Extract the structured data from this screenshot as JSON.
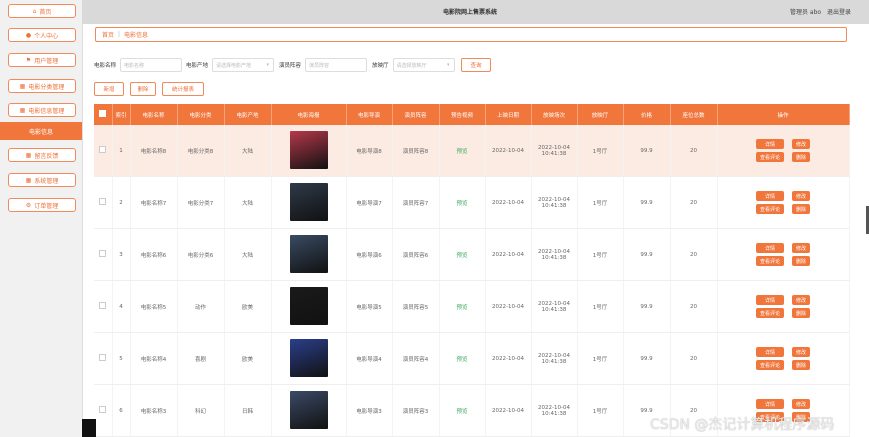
{
  "header": {
    "title": "电影院网上售票系统",
    "admin": "管理员 abo",
    "logout": "退出登录"
  },
  "sidebar": {
    "items": [
      {
        "label": "首页",
        "icon": "home-icon",
        "glyph": "⌂"
      },
      {
        "label": "个人中心",
        "icon": "user-icon",
        "glyph": "●"
      },
      {
        "label": "用户管理",
        "icon": "flag-icon",
        "glyph": "⚑"
      },
      {
        "label": "电影分类管理",
        "icon": "grid-icon",
        "glyph": "▦"
      },
      {
        "label": "电影信息管理",
        "icon": "grid-icon",
        "glyph": "▦"
      },
      {
        "label": "电影信息",
        "icon": "",
        "glyph": ""
      },
      {
        "label": "留言反馈",
        "icon": "grid-icon",
        "glyph": "▦"
      },
      {
        "label": "系统管理",
        "icon": "grid-icon",
        "glyph": "▦"
      },
      {
        "label": "订单管理",
        "icon": "settings-icon",
        "glyph": "⚙"
      }
    ]
  },
  "breadcrumb": {
    "home": "首页",
    "sep": "|",
    "current": "电影信息"
  },
  "filters": {
    "name_label": "电影名称",
    "name_placeholder": "电影名称",
    "origin_label": "电影产地",
    "origin_placeholder": "请选择电影产地",
    "cast_label": "演员阵容",
    "cast_placeholder": "演员阵容",
    "hall_label": "放映厅",
    "hall_placeholder": "请选择放映厅",
    "search": "查询"
  },
  "toolbar": {
    "add": "新增",
    "delete": "删除",
    "report": "统计报表"
  },
  "table": {
    "headers": [
      "",
      "索引",
      "电影名称",
      "电影分类",
      "电影产地",
      "电影海报",
      "电影导演",
      "演员阵容",
      "预告视频",
      "上映日期",
      "放映场次",
      "放映厅",
      "价格",
      "座位总数",
      "操作"
    ],
    "rows": [
      {
        "index": "1",
        "name": "电影名称8",
        "category": "电影分类8",
        "origin": "大陆",
        "director": "电影导演8",
        "cast": "演员阵容8",
        "video": "预览",
        "date": "2022-10-04",
        "session": "2022-10-04 10:41:38",
        "hall": "1号厅",
        "price": "99.9",
        "seats": "20"
      },
      {
        "index": "2",
        "name": "电影名称7",
        "category": "电影分类7",
        "origin": "大陆",
        "director": "电影导演7",
        "cast": "演员阵容7",
        "video": "预览",
        "date": "2022-10-04",
        "session": "2022-10-04 10:41:38",
        "hall": "1号厅",
        "price": "99.9",
        "seats": "20"
      },
      {
        "index": "3",
        "name": "电影名称6",
        "category": "电影分类6",
        "origin": "大陆",
        "director": "电影导演6",
        "cast": "演员阵容6",
        "video": "预览",
        "date": "2022-10-04",
        "session": "2022-10-04 10:41:38",
        "hall": "1号厅",
        "price": "99.9",
        "seats": "20"
      },
      {
        "index": "4",
        "name": "电影名称5",
        "category": "动作",
        "origin": "欧美",
        "director": "电影导演5",
        "cast": "演员阵容5",
        "video": "预览",
        "date": "2022-10-04",
        "session": "2022-10-04 10:41:38",
        "hall": "1号厅",
        "price": "99.9",
        "seats": "20"
      },
      {
        "index": "5",
        "name": "电影名称4",
        "category": "喜剧",
        "origin": "欧美",
        "director": "电影导演4",
        "cast": "演员阵容4",
        "video": "预览",
        "date": "2022-10-04",
        "session": "2022-10-04 10:41:38",
        "hall": "1号厅",
        "price": "99.9",
        "seats": "20"
      },
      {
        "index": "6",
        "name": "电影名称3",
        "category": "科幻",
        "origin": "日韩",
        "director": "电影导演3",
        "cast": "演员阵容3",
        "video": "预览",
        "date": "2022-10-04",
        "session": "2022-10-04 10:41:38",
        "hall": "1号厅",
        "price": "99.9",
        "seats": "20"
      }
    ],
    "actions": {
      "detail": "详情",
      "edit": "修改",
      "comments": "查看评论",
      "delete": "删除"
    }
  },
  "poster_colors": [
    "#b5384a",
    "#2e3a4a",
    "#394b63",
    "#1a1a1a",
    "#2b3f8c",
    "#3b4a66"
  ],
  "watermark": "CSDN @杰记计算机程序源码",
  "colors": {
    "accent": "#f0763c",
    "highlight_row": "#fcebe2"
  }
}
